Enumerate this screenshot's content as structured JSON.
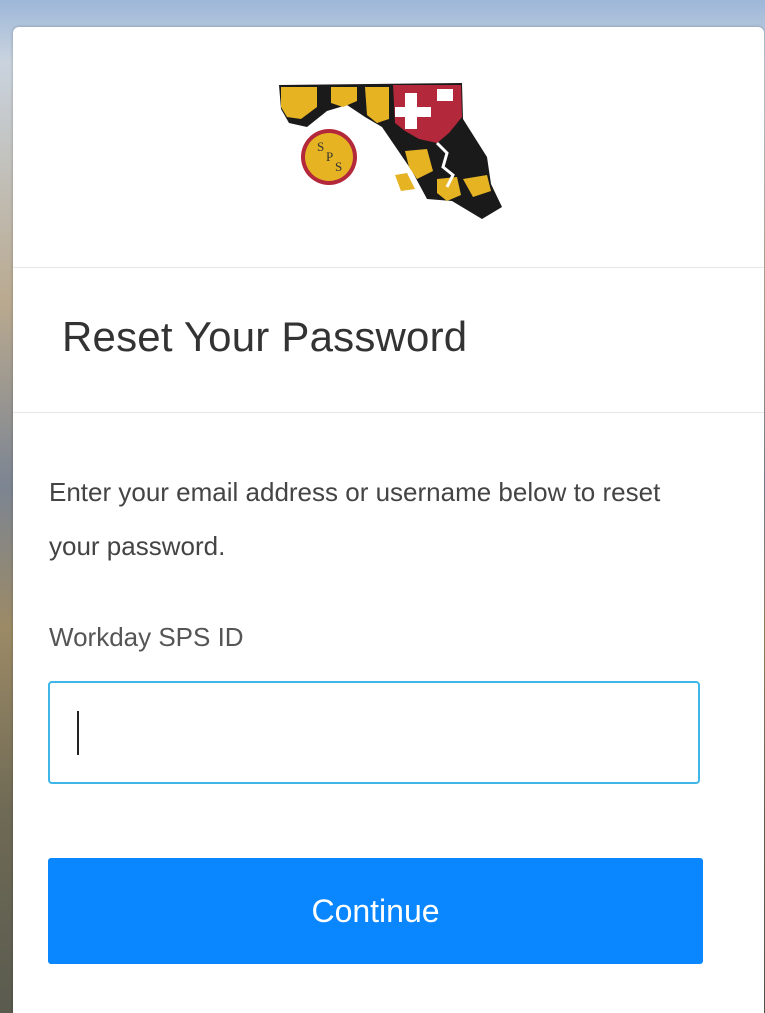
{
  "logo": {
    "text_top": "S",
    "text_mid": "P",
    "text_bottom": "S",
    "colors": {
      "gold": "#e6b323",
      "black": "#1a1a1a",
      "red": "#b3283a",
      "white": "#ffffff"
    }
  },
  "heading": {
    "title": "Reset Your Password"
  },
  "form": {
    "description": "Enter your email address or username below to reset your password.",
    "field_label": "Workday SPS ID",
    "field_value": "",
    "field_placeholder": ""
  },
  "actions": {
    "continue_label": "Continue"
  },
  "colors": {
    "accent": "#0a87ff",
    "input_border": "#3fb6e8"
  }
}
